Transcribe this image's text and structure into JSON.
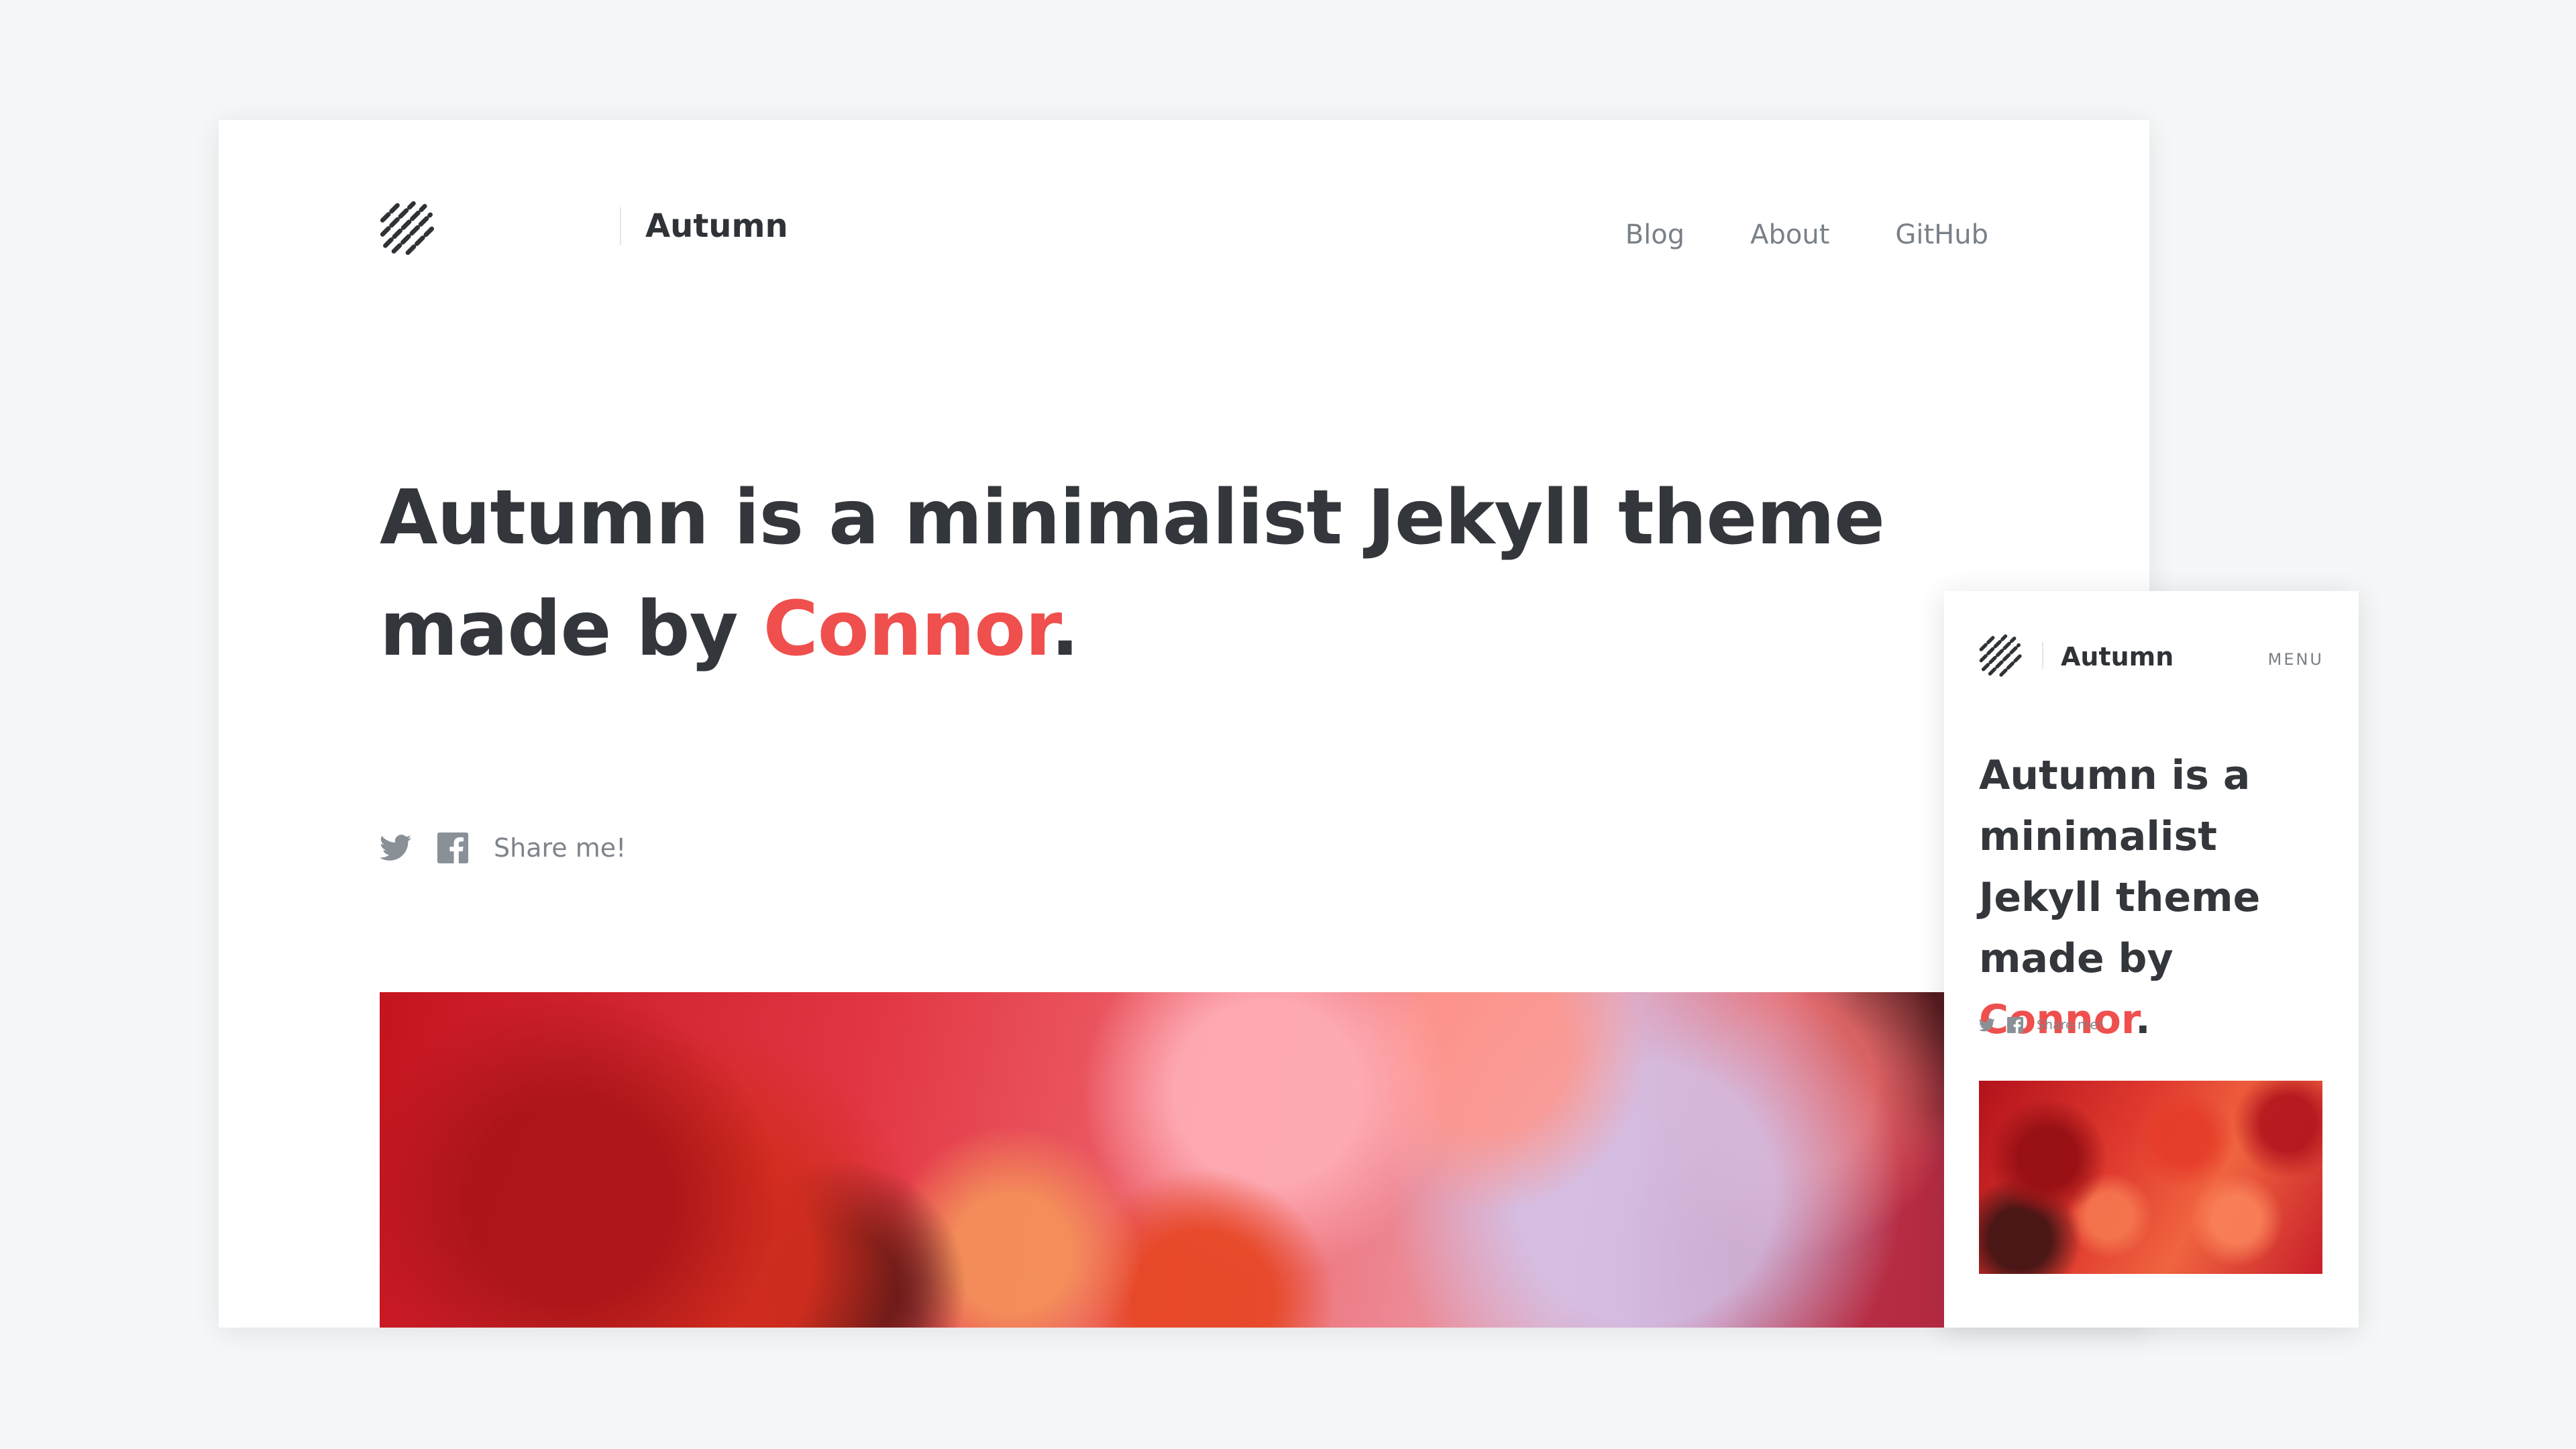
{
  "desktop": {
    "brand": "Autumn",
    "nav": [
      {
        "label": "Blog"
      },
      {
        "label": "About"
      },
      {
        "label": "GitHub"
      }
    ],
    "title_main": "Autumn is a minimalist Jekyll theme made by ",
    "title_accent": "Connor",
    "title_end": ".",
    "share_label": "Share me!",
    "icons": {
      "logo": "diagonal-stripes-logo-icon",
      "twitter": "twitter-icon",
      "facebook": "facebook-icon"
    }
  },
  "mobile": {
    "brand": "Autumn",
    "menu_label": "MENU",
    "title_main": "Autumn is a minimalist Jekyll theme made by ",
    "title_accent": "Connor",
    "title_end": ".",
    "share_label": "Share me!"
  },
  "colors": {
    "accent": "#ef4f4d",
    "text_dark": "#33363b",
    "text_muted": "#7a8088",
    "background": "#f5f7f8"
  }
}
